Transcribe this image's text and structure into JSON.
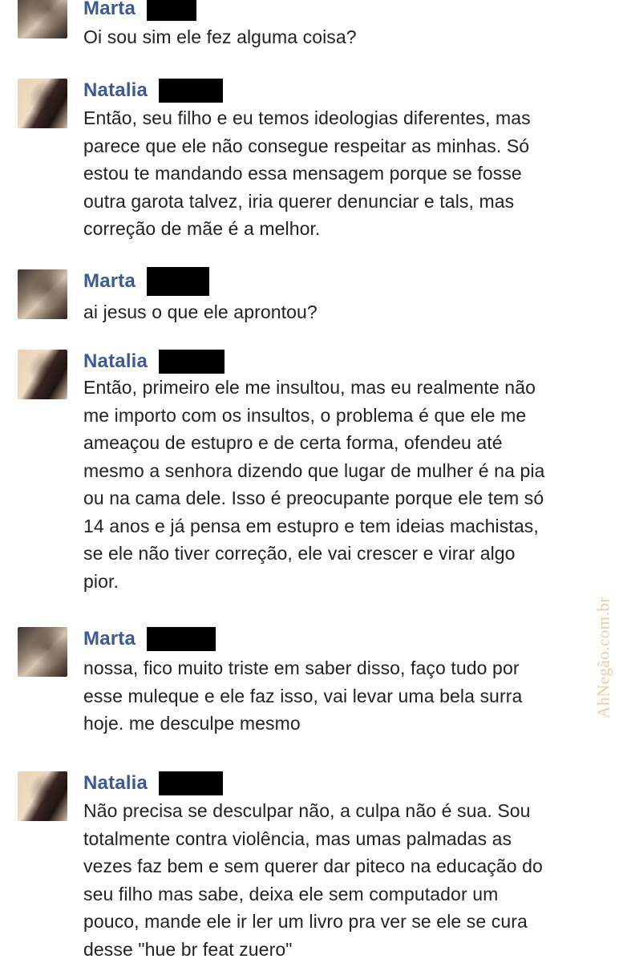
{
  "messages": [
    {
      "sender": "Marta",
      "avatar": "avatar-marta",
      "lines": [
        "Oi sou sim ele fez alguma coisa?"
      ]
    },
    {
      "sender": "Natalia",
      "avatar": "avatar-natalia",
      "lines": [
        "Então, seu filho e eu temos ideologias diferentes, mas",
        "parece que ele não consegue respeitar as minhas. Só",
        "estou te mandando essa mensagem porque se fosse",
        "outra garota talvez, iria querer denunciar e tals, mas",
        "correção de mãe é a melhor."
      ]
    },
    {
      "sender": "Marta",
      "avatar": "avatar-marta",
      "lines": [
        "ai jesus o que ele aprontou?"
      ]
    },
    {
      "sender": "Natalia",
      "avatar": "avatar-natalia",
      "lines": [
        "Então, primeiro ele me insultou, mas eu realmente não",
        "me importo com os insultos, o problema é que ele me",
        "ameaçou de estupro e de certa forma, ofendeu até",
        "mesmo a senhora dizendo que lugar de mulher é na pia",
        "ou na cama dele. Isso é preocupante porque ele tem só",
        "14 anos e já pensa em estupro e tem ideias machistas,",
        "se ele não tiver correção, ele vai crescer e virar algo",
        "pior."
      ]
    },
    {
      "sender": "Marta",
      "avatar": "avatar-marta",
      "lines": [
        "nossa, fico muito triste em saber disso, faço tudo por",
        "esse muleque e ele faz isso, vai levar uma bela surra",
        "hoje. me desculpe mesmo"
      ]
    },
    {
      "sender": "Natalia",
      "avatar": "avatar-natalia",
      "lines": [
        "Não precisa se desculpar não, a culpa não é sua. Sou",
        "totalmente contra violência, mas umas palmadas as",
        "vezes faz bem e sem querer dar piteco na educação do",
        "seu filho mas sabe, deixa ele sem computador um",
        "pouco, mande ele ir ler um livro pra ver se ele se cura",
        "desse \"hue br feat zuero\""
      ]
    }
  ],
  "watermark": "AhNegão.com.br",
  "colors": {
    "sender_name": "#3b5998",
    "message_text": "#222222",
    "redaction": "#000000",
    "watermark": "#f3c9a0"
  }
}
